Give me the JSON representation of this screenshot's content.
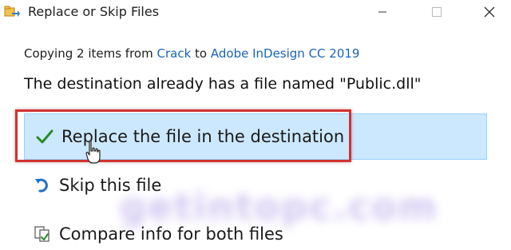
{
  "window": {
    "title": "Replace or Skip Files"
  },
  "copying": {
    "prefix": "Copying 2 items from ",
    "source": "Crack",
    "middle": " to ",
    "destination": "Adobe InDesign CC 2019"
  },
  "heading": "The destination already has a file named \"Public.dll\"",
  "options": {
    "replace_label": "Replace the file in the destination",
    "skip_label": "Skip this file",
    "compare_label": "Compare info for both files"
  },
  "watermark": "getintopc.com",
  "colors": {
    "accent_link": "#1a64b8",
    "selected_bg": "#cce8ff",
    "check_green": "#2a8a2a",
    "highlight_red": "#d23232"
  },
  "icons": {
    "app": "move-files-icon",
    "replace": "checkmark-icon",
    "skip": "skip-arrow-icon",
    "compare": "compare-files-icon"
  }
}
